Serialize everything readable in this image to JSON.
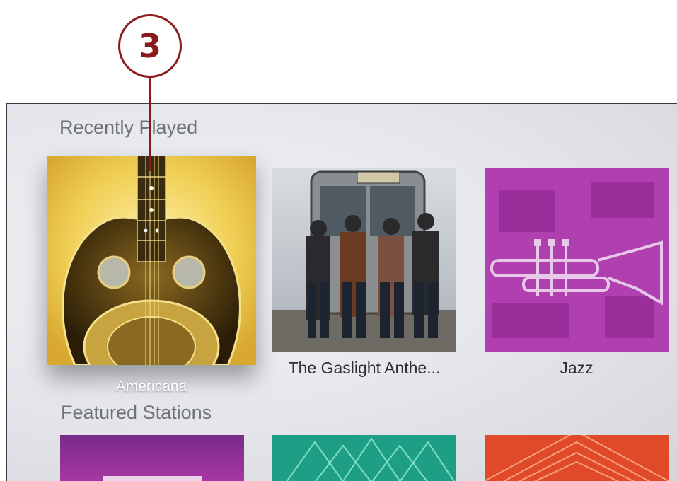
{
  "callout": {
    "number": "3"
  },
  "recently_played": {
    "title": "Recently Played",
    "items": [
      {
        "label": "Americana",
        "art_icon": "resonator-guitar-icon",
        "focused": true
      },
      {
        "label": "The Gaslight Anthe...",
        "art_icon": "band-photo-icon",
        "focused": false
      },
      {
        "label": "Jazz",
        "art_icon": "trumpet-icon",
        "focused": false
      }
    ]
  },
  "featured_stations": {
    "title": "Featured Stations",
    "items": [
      {
        "art_icon": "purple-station-art"
      },
      {
        "art_icon": "teal-station-art"
      },
      {
        "art_icon": "orange-station-art"
      }
    ]
  },
  "colors": {
    "callout": "#8b1a1a",
    "americana_bg": "#f0d060",
    "jazz_bg": "#b040b0"
  }
}
